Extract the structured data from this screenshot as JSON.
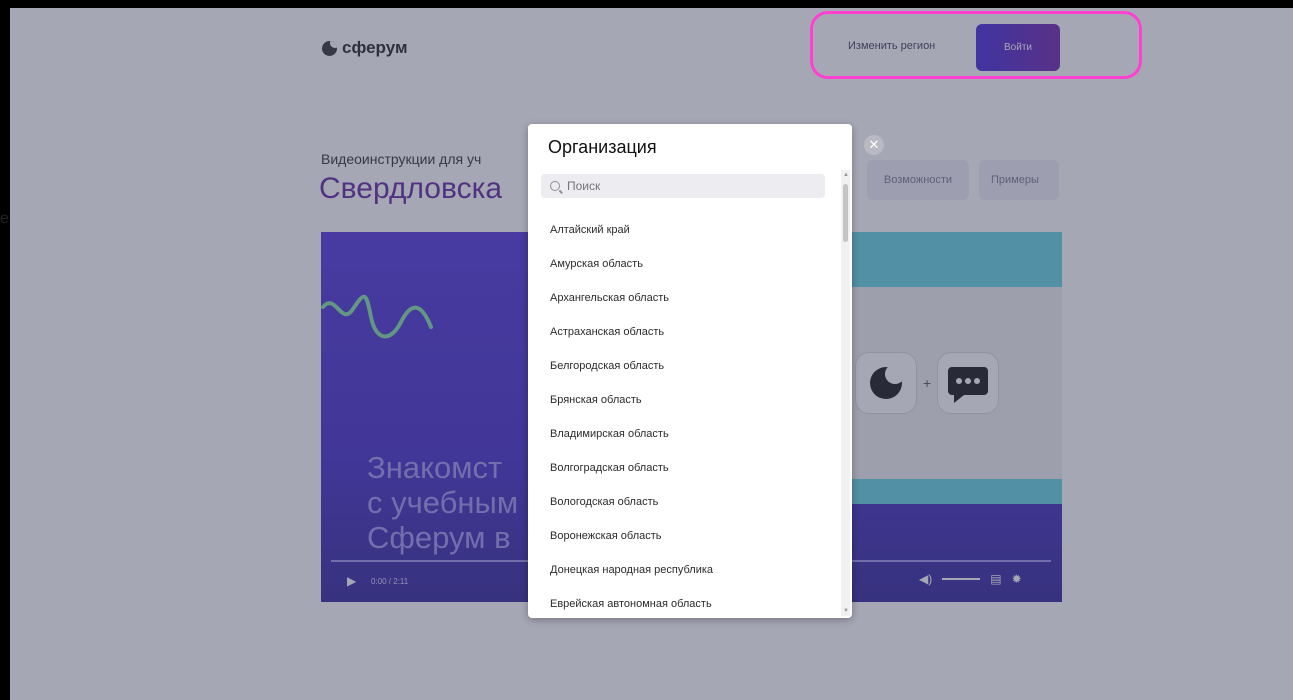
{
  "header": {
    "logo_text": "сферум",
    "change_region": "Изменить регион",
    "login": "Войти"
  },
  "page": {
    "subtitle": "Видеоинструкции для уч",
    "region_title": "Свердловска",
    "tab_features": "Возможности",
    "tab_examples": "Примеры",
    "stray_char": "е"
  },
  "video": {
    "text_line1": "Знакомст",
    "text_line2": "с учебным",
    "text_line3": "Сферум в",
    "time": "0:00 / 2:11"
  },
  "modal": {
    "title": "Организация",
    "search_placeholder": "Поиск",
    "items": [
      "Алтайский край",
      "Амурская область",
      "Архангельская область",
      "Астраханская область",
      "Белгородская область",
      "Брянская область",
      "Владимирская область",
      "Волгоградская область",
      "Вологодская область",
      "Воронежская область",
      "Донецкая народная республика",
      "Еврейская автономная область"
    ]
  },
  "colors": {
    "accent": "#5b1e9d",
    "highlight": "#ff40d0",
    "video_bg": "#4b2fd8"
  }
}
